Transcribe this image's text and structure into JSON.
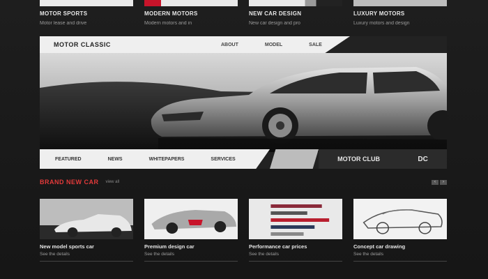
{
  "top_cards": [
    {
      "title": "MOTOR SPORTS",
      "subtitle": "Motor lease and drive"
    },
    {
      "title": "MODERN MOTORS",
      "subtitle": "Modern motors and in"
    },
    {
      "title": "NEW CAR DESIGN",
      "subtitle": "New car design and pro"
    },
    {
      "title": "LUXURY MOTORS",
      "subtitle": "Luxury motors and design"
    }
  ],
  "hero": {
    "brand": "MOTOR CLASSIC",
    "nav": [
      "ABOUT",
      "MODEL",
      "SALE"
    ],
    "bottom_links": [
      "FEATURED",
      "NEWS",
      "WHITEPAPERS",
      "SERVICES"
    ],
    "right_label_a": "MOTOR CLUB",
    "right_label_b": "DC"
  },
  "section": {
    "title": "BRAND NEW CAR",
    "more": "view all",
    "pager": [
      "‹",
      "›"
    ]
  },
  "cards": [
    {
      "title": "New model sports car",
      "subtitle": "See the details"
    },
    {
      "title": "Premium design car",
      "subtitle": "See the details"
    },
    {
      "title": "Performance car prices",
      "subtitle": "See the details"
    },
    {
      "title": "Concept car drawing",
      "subtitle": "See the details"
    }
  ],
  "colors": {
    "accent": "#e23a3a",
    "background": "#1b1b1b",
    "panel": "#efefef"
  }
}
